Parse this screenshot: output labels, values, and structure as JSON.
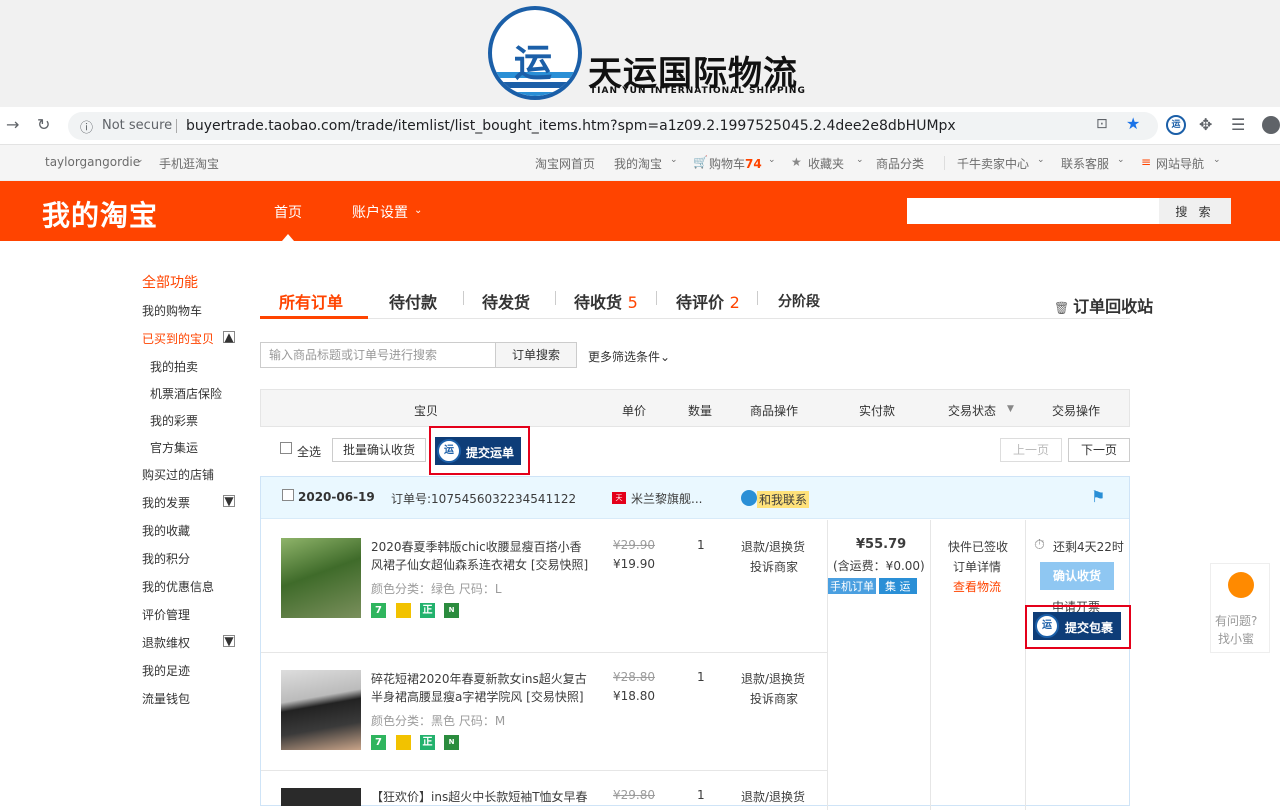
{
  "banner": {
    "name": "天运国际物流",
    "sub": "TIAN YUN INTERNATIONAL SHIPPING",
    "logo_text": "运"
  },
  "browser": {
    "not_secure": "Not secure",
    "url": "buyertrade.taobao.com/trade/itemlist/list_bought_items.htm?spm=a1z09.2.1997525045.2.4dee2e8dbHUMpx",
    "ext_label": "运"
  },
  "site_nav": {
    "user": "taylorgangordie",
    "mobile": "手机逛淘宝",
    "home": "淘宝网首页",
    "my_taobao": "我的淘宝",
    "cart_label": "购物车",
    "cart_count": "74",
    "favorites": "收藏夹",
    "categories": "商品分类",
    "seller": "千牛卖家中心",
    "service": "联系客服",
    "sitemap": "网站导航"
  },
  "header": {
    "logo": "我的淘宝",
    "home": "首页",
    "account": "账户设置",
    "search_btn": "搜 索"
  },
  "leftnav": {
    "all": "全部功能",
    "cart": "我的购物车",
    "bought": "已买到的宝贝",
    "auction": "我的拍卖",
    "ticket": "机票酒店保险",
    "lottery": "我的彩票",
    "consolidate": "官方集运",
    "shops": "购买过的店铺",
    "invoice": "我的发票",
    "favorites": "我的收藏",
    "points": "我的积分",
    "coupons": "我的优惠信息",
    "reviews": "评价管理",
    "refund": "退款维权",
    "footprints": "我的足迹",
    "wallet": "流量钱包"
  },
  "tabs": {
    "all": "所有订单",
    "to_pay": "待付款",
    "to_ship": "待发货",
    "to_receive": "待收货",
    "to_receive_count": "5",
    "to_review": "待评价",
    "to_review_count": "2",
    "stage": "分阶段",
    "recycle": "订单回收站"
  },
  "filter": {
    "placeholder": "输入商品标题或订单号进行搜索",
    "search_btn": "订单搜索",
    "more": "更多筛选条件"
  },
  "table_head": {
    "item": "宝贝",
    "unit_price": "单价",
    "qty": "数量",
    "item_ops": "商品操作",
    "paid": "实付款",
    "status": "交易状态",
    "trade_ops": "交易操作"
  },
  "actions": {
    "select_all": "全选",
    "batch_confirm": "批量确认收货",
    "submit_waybill": "提交运单",
    "prev": "上一页",
    "next": "下一页"
  },
  "order": {
    "date": "2020-06-19",
    "order_no_label": "订单号:",
    "order_no": "1075456032234541122",
    "shop": "米兰黎旗舰...",
    "contact": "和我联系",
    "total": "¥55.79",
    "shipping": "(含运费：¥0.00)",
    "tag_mobile": "手机订单",
    "tag_consolidate": "集 运",
    "status": "快件已签收",
    "detail": "订单详情",
    "logistics": "查看物流",
    "countdown": "还剩4天22时",
    "confirm": "确认收货",
    "invoice": "申请开票",
    "submit_parcel": "提交包裹",
    "items": [
      {
        "title": "2020春夏季韩版chic收腰显瘦百搭小香风裙子仙女超仙森系连衣裙女 [交易快照]",
        "sku": "颜色分类：绿色  尺码：L",
        "orig": "¥29.90",
        "price": "¥19.90",
        "qty": "1",
        "op1": "退款/退换货",
        "op2": "投诉商家"
      },
      {
        "title": "碎花短裙2020年春夏新款女ins超火复古半身裙高腰显瘦a字裙学院风 [交易快照]",
        "sku": "颜色分类：黑色  尺码：M",
        "orig": "¥28.80",
        "price": "¥18.80",
        "qty": "1",
        "op1": "退款/退换货",
        "op2": "投诉商家"
      },
      {
        "title": "【狂欢价】ins超火中长款短袖T恤女早春",
        "orig": "¥29.80",
        "qty": "1",
        "op1": "退款/退换货"
      }
    ],
    "badges": [
      "7",
      "正"
    ]
  },
  "float_help": {
    "line1": "有问题?",
    "line2": "找小蜜"
  }
}
